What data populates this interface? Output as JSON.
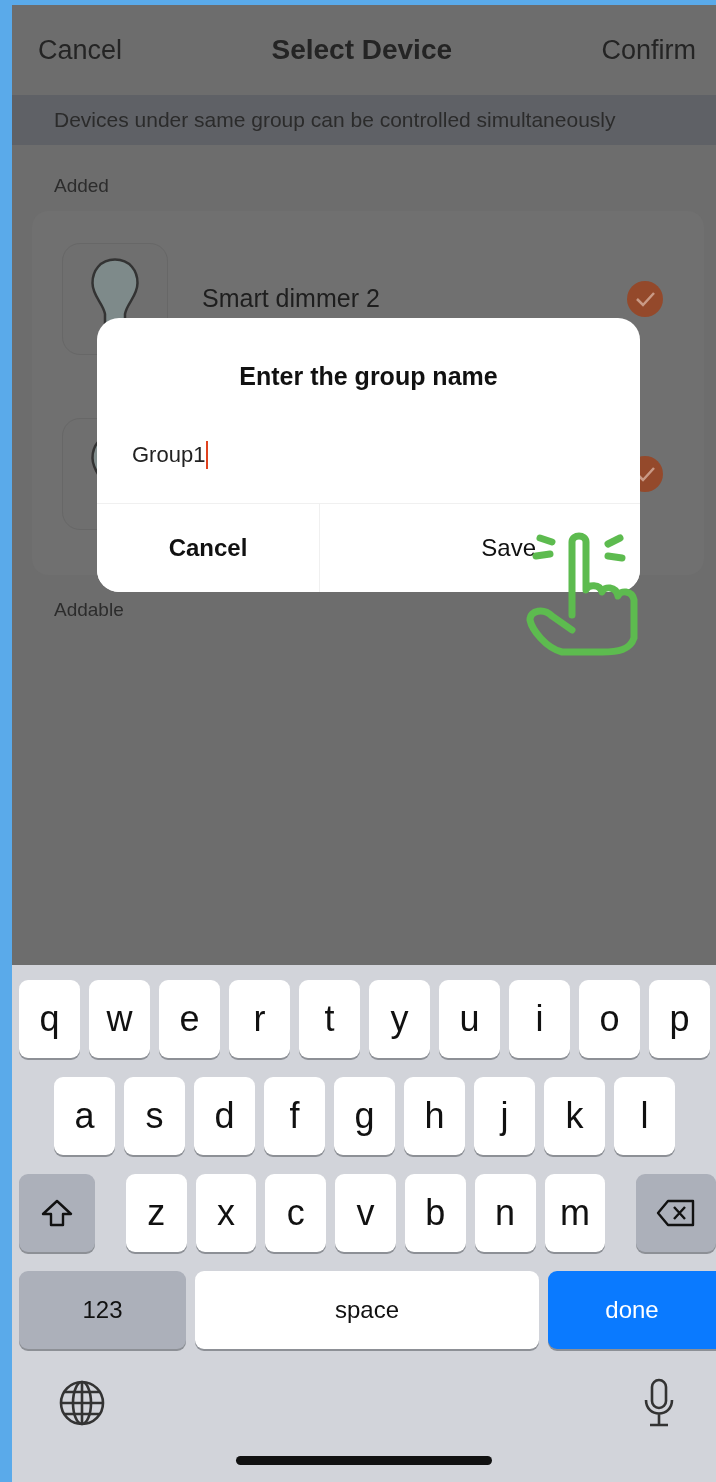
{
  "nav": {
    "cancel": "Cancel",
    "title": "Select Device",
    "confirm": "Confirm"
  },
  "banner": "Devices under same group can be controlled simultaneously",
  "added_label": "Added",
  "devices": [
    {
      "name": "Smart dimmer 2",
      "checked": true
    },
    {
      "checked": true
    }
  ],
  "addable_label": "Addable",
  "dialog": {
    "title": "Enter the group name",
    "value": "Group1",
    "buttons": [
      {
        "label": "Cancel",
        "kind": "cancel"
      },
      {
        "label": "Save",
        "kind": "save"
      }
    ]
  },
  "keyboard": {
    "rows": [
      [
        {
          "kind": "letter",
          "label": "q"
        },
        {
          "kind": "letter",
          "label": "w"
        },
        {
          "kind": "letter",
          "label": "e"
        },
        {
          "kind": "letter",
          "label": "r"
        },
        {
          "kind": "letter",
          "label": "t"
        },
        {
          "kind": "letter",
          "label": "y"
        },
        {
          "kind": "letter",
          "label": "u"
        },
        {
          "kind": "letter",
          "label": "i"
        },
        {
          "kind": "letter",
          "label": "o"
        },
        {
          "kind": "letter",
          "label": "p"
        }
      ],
      [
        {
          "kind": "letter",
          "label": "a"
        },
        {
          "kind": "letter",
          "label": "s"
        },
        {
          "kind": "letter",
          "label": "d"
        },
        {
          "kind": "letter",
          "label": "f"
        },
        {
          "kind": "letter",
          "label": "g"
        },
        {
          "kind": "letter",
          "label": "h"
        },
        {
          "kind": "letter",
          "label": "j"
        },
        {
          "kind": "letter",
          "label": "k"
        },
        {
          "kind": "letter",
          "label": "l"
        }
      ],
      [
        {
          "kind": "shift"
        },
        {
          "kind": "letter",
          "label": "z"
        },
        {
          "kind": "letter",
          "label": "x"
        },
        {
          "kind": "letter",
          "label": "c"
        },
        {
          "kind": "letter",
          "label": "v"
        },
        {
          "kind": "letter",
          "label": "b"
        },
        {
          "kind": "letter",
          "label": "n"
        },
        {
          "kind": "letter",
          "label": "m"
        },
        {
          "kind": "delete"
        }
      ]
    ],
    "numbers_key": "123",
    "space_key": "space",
    "done_key": "done"
  }
}
